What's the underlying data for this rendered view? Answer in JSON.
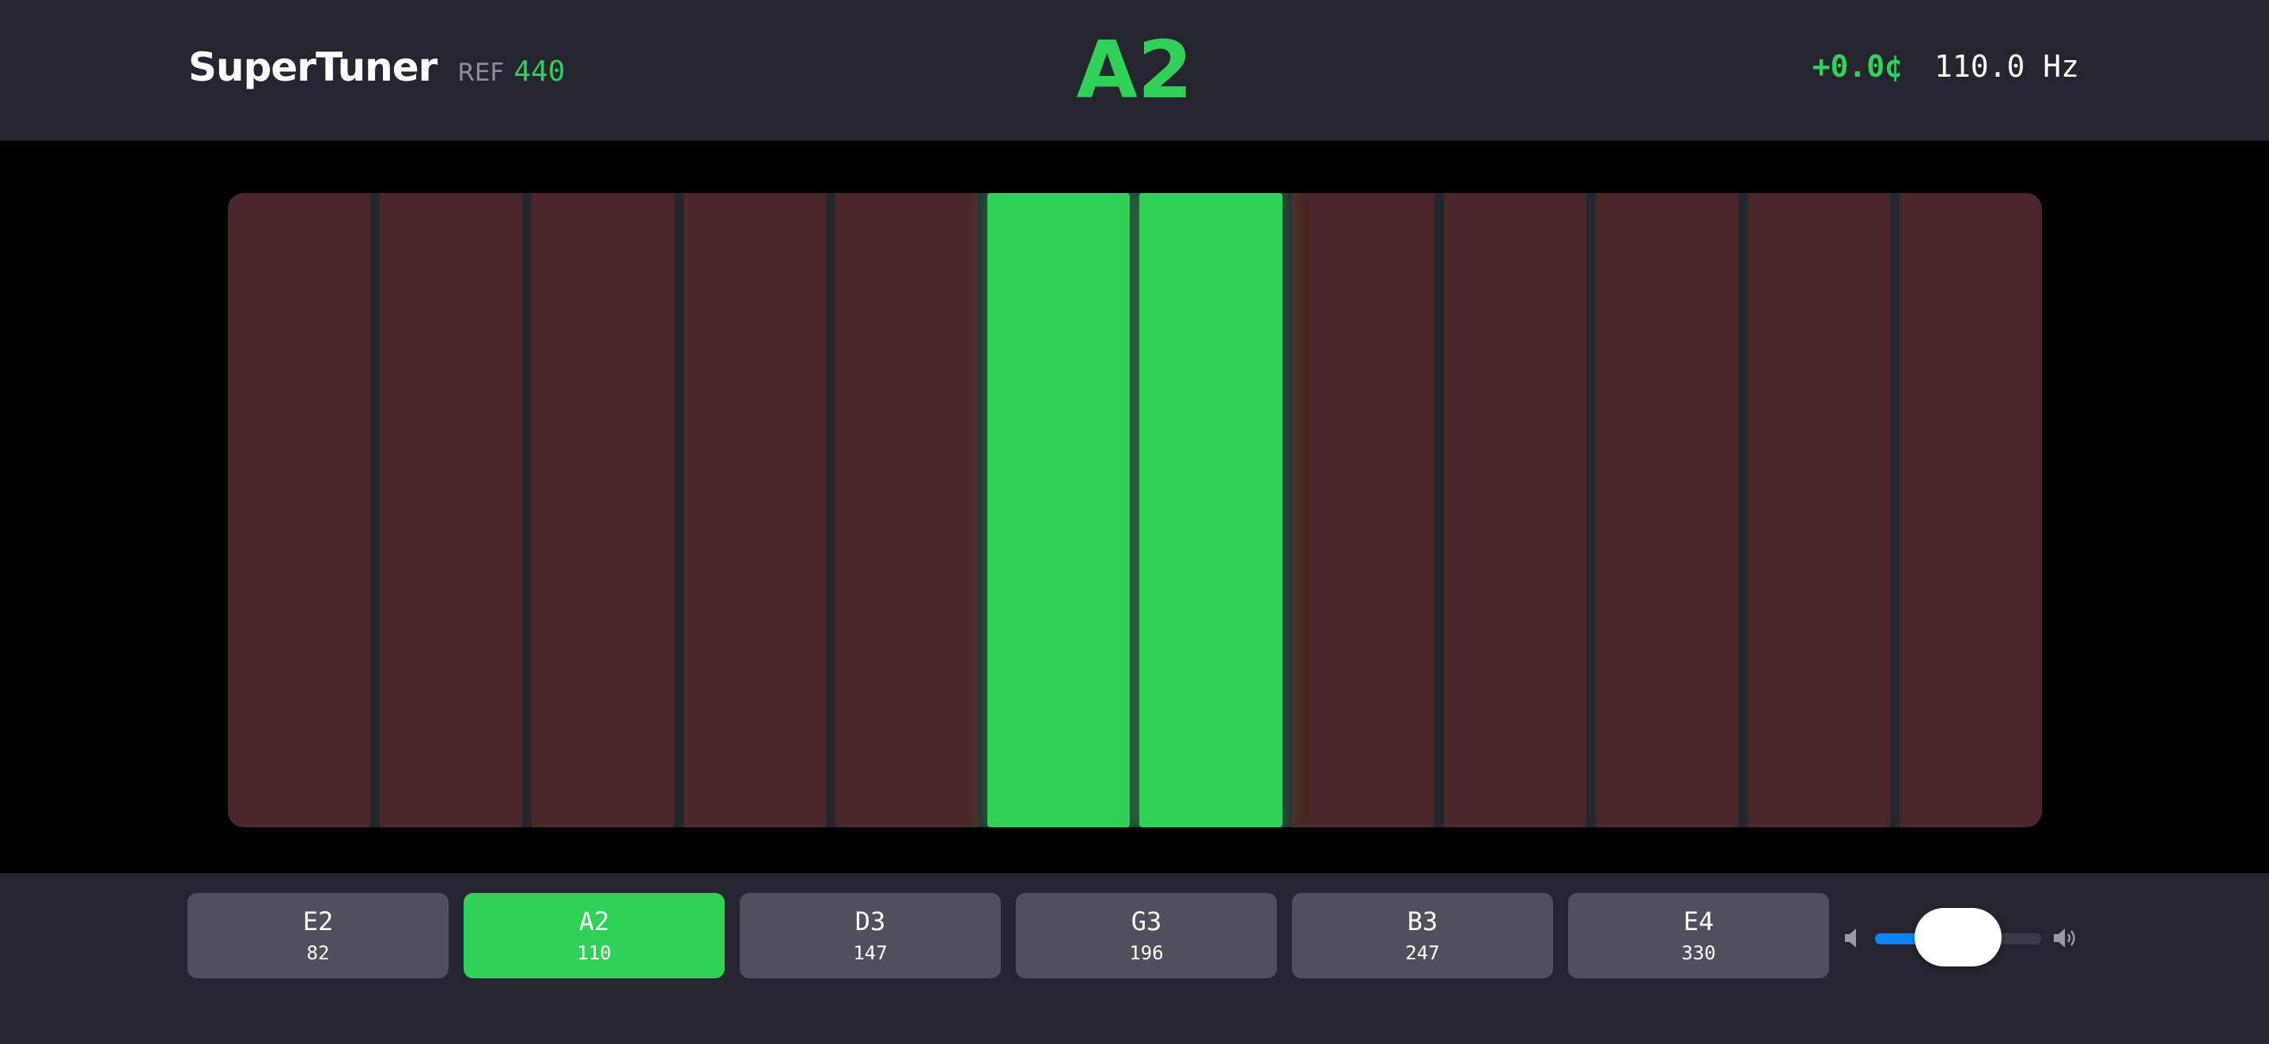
{
  "app": {
    "title": "SuperTuner",
    "ref_label": "REF",
    "ref_value": "440"
  },
  "tuner": {
    "note": "A2",
    "cents": "+0.0¢",
    "frequency": "110.0 Hz"
  },
  "meter": {
    "bar_count": 12,
    "active_bars": [
      5,
      6
    ],
    "colors": {
      "inactive": "#4b2628",
      "active": "#30d158"
    }
  },
  "strings": [
    {
      "note": "E2",
      "hz": "82",
      "active": false
    },
    {
      "note": "A2",
      "hz": "110",
      "active": true
    },
    {
      "note": "D3",
      "hz": "147",
      "active": false
    },
    {
      "note": "G3",
      "hz": "196",
      "active": false
    },
    {
      "note": "B3",
      "hz": "247",
      "active": false
    },
    {
      "note": "E4",
      "hz": "330",
      "active": false
    }
  ],
  "volume": {
    "level": 0.4,
    "low_icon": "speaker-low-icon",
    "high_icon": "speaker-high-icon"
  },
  "colors": {
    "accent": "#30d158",
    "background": "#24252f",
    "slider_fill": "#0a84ff"
  }
}
